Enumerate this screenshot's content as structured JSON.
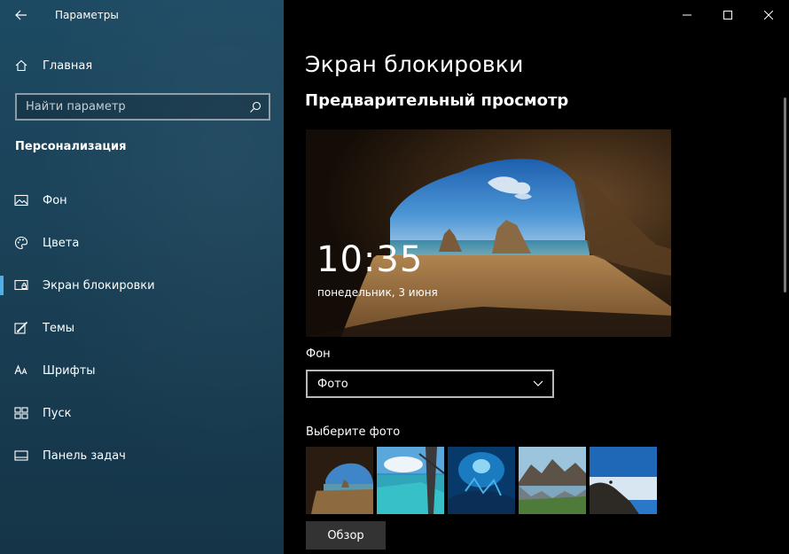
{
  "app": {
    "title": "Параметры"
  },
  "sidebar": {
    "home_label": "Главная",
    "search_placeholder": "Найти параметр",
    "section_title": "Персонализация",
    "items": [
      {
        "label": "Фон",
        "icon": "picture-icon",
        "active": false
      },
      {
        "label": "Цвета",
        "icon": "palette-icon",
        "active": false
      },
      {
        "label": "Экран блокировки",
        "icon": "lock-screen-icon",
        "active": true
      },
      {
        "label": "Темы",
        "icon": "brush-icon",
        "active": false
      },
      {
        "label": "Шрифты",
        "icon": "font-icon",
        "active": false
      },
      {
        "label": "Пуск",
        "icon": "start-grid-icon",
        "active": false
      },
      {
        "label": "Панель задач",
        "icon": "taskbar-icon",
        "active": false
      }
    ]
  },
  "main": {
    "title": "Экран блокировки",
    "preview_heading": "Предварительный просмотр",
    "preview": {
      "time": "10:35",
      "date": "понедельник, 3 июня"
    },
    "background_label": "Фон",
    "background_value": "Фото",
    "choose_photo_label": "Выберите фото",
    "photos": [
      "cave-beach",
      "ocean-window",
      "underwater-blue",
      "mountain-lake",
      "cliff-sky"
    ],
    "browse_label": "Обзор"
  },
  "colors": {
    "sidebar_bg": "#1a4157",
    "accent": "#4fb0e6",
    "content_bg": "#000000"
  }
}
